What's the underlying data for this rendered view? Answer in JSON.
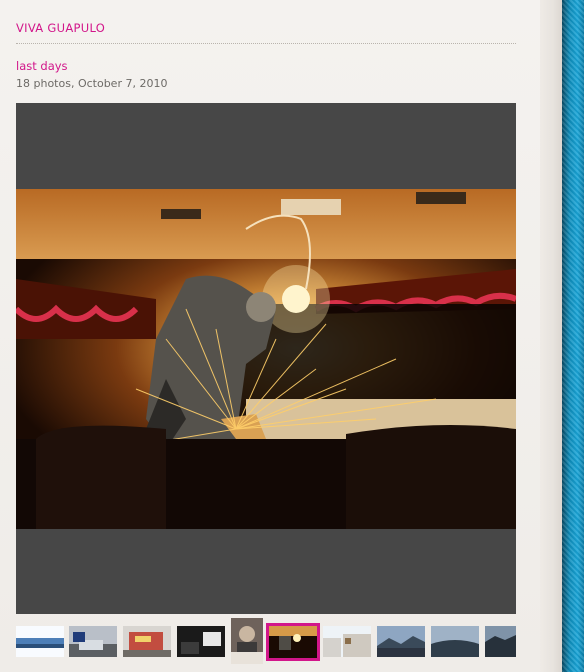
{
  "site": {
    "title": "VIVA GUAPULO"
  },
  "album": {
    "title": "last days",
    "meta": "18 photos, October 7, 2010"
  },
  "viewer": {
    "photo_description_icon": "welding-van-photo"
  },
  "thumbnails": [
    {
      "name": "thumb-horizon"
    },
    {
      "name": "thumb-street-car"
    },
    {
      "name": "thumb-graffiti-wall"
    },
    {
      "name": "thumb-van-door"
    },
    {
      "name": "thumb-person-portrait"
    },
    {
      "name": "thumb-welding-van",
      "selected": true
    },
    {
      "name": "thumb-houses"
    },
    {
      "name": "thumb-mountain-clouds"
    },
    {
      "name": "thumb-valley-view"
    },
    {
      "name": "thumb-hillside"
    }
  ],
  "colors": {
    "accent": "#d2168a",
    "viewer_bg": "#474747",
    "page_bg": "#f1eeea"
  }
}
